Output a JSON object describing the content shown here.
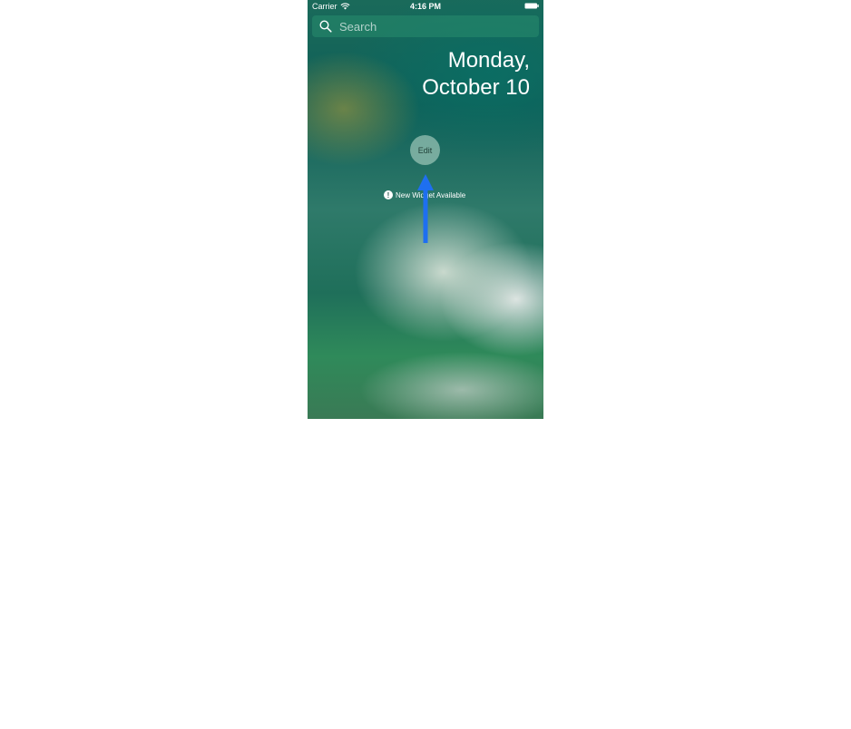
{
  "status_bar": {
    "carrier": "Carrier",
    "time": "4:16 PM"
  },
  "search": {
    "placeholder": "Search"
  },
  "date": {
    "line1": "Monday,",
    "line2": "October 10"
  },
  "edit_button": {
    "label": "Edit"
  },
  "notice": {
    "icon_glyph": "!",
    "text": "New Widget Available"
  },
  "colors": {
    "arrow": "#1e6ff0",
    "accent": "#ffffff"
  }
}
